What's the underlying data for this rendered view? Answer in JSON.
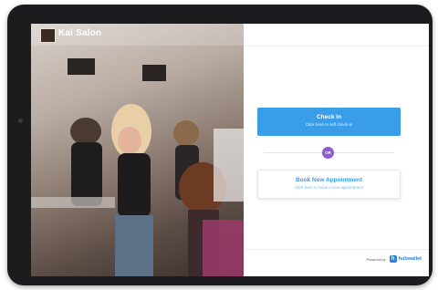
{
  "brand": {
    "name": "Kai Salon",
    "logo": "salon-logo"
  },
  "checkin": {
    "title": "Check In",
    "subtitle": "Click here to self check-in"
  },
  "divider": {
    "label": "OR"
  },
  "book": {
    "title": "Book New Appointment",
    "subtitle": "Click here to book a new appointment"
  },
  "footer": {
    "powered_by": "Powered by",
    "vendor_name": "hubwallet",
    "vendor_icon": "h"
  },
  "colors": {
    "primary": "#3a9de8",
    "or_badge": "#8f59d6",
    "vendor": "#2f7fd6"
  }
}
